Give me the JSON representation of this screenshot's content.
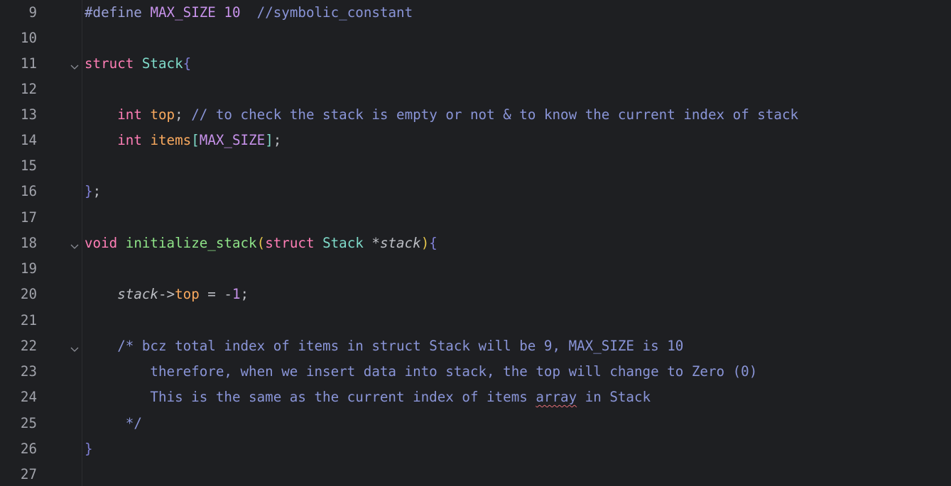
{
  "colors": {
    "background": "#1e1f22",
    "line_number": "#a1a3ab",
    "keyword": "#ff7eb6",
    "type": "#7fdbca",
    "function": "#8fe388",
    "field": "#f9a95e",
    "macro": "#c792ea",
    "comment": "#8a95d8"
  },
  "lines": [
    {
      "n": "9"
    },
    {
      "n": "10"
    },
    {
      "n": "11"
    },
    {
      "n": "12"
    },
    {
      "n": "13"
    },
    {
      "n": "14"
    },
    {
      "n": "15"
    },
    {
      "n": "16"
    },
    {
      "n": "17"
    },
    {
      "n": "18"
    },
    {
      "n": "19"
    },
    {
      "n": "20"
    },
    {
      "n": "21"
    },
    {
      "n": "22"
    },
    {
      "n": "23"
    },
    {
      "n": "24"
    },
    {
      "n": "25"
    },
    {
      "n": "26"
    },
    {
      "n": "27"
    }
  ],
  "code": {
    "l9_define": "#define",
    "l9_name": "MAX_SIZE",
    "l9_value": "10",
    "l9_comment": "//symbolic_constant",
    "l11_struct": "struct",
    "l11_name": "Stack",
    "l11_brace": "{",
    "l13_int": "int",
    "l13_top": "top",
    "l13_semi": ";",
    "l13_comment": "// to check the stack is empty or not & to know the current index of stack",
    "l14_int": "int",
    "l14_items": "items",
    "l14_lb": "[",
    "l14_max": "MAX_SIZE",
    "l14_rb": "]",
    "l14_semi": ";",
    "l16_close": "}",
    "l16_semi": ";",
    "l18_void": "void",
    "l18_fn": "initialize_stack",
    "l18_lp": "(",
    "l18_struct": "struct",
    "l18_type": "Stack",
    "l18_star": "*",
    "l18_param": "stack",
    "l18_rp": ")",
    "l18_brace": "{",
    "l20_stack": "stack",
    "l20_arrow": "->",
    "l20_top": "top",
    "l20_eq": " = ",
    "l20_minus": "-",
    "l20_num": "1",
    "l20_semi": ";",
    "l22_comment": "/* bcz total index of items in struct Stack will be 9, MAX_SIZE is 10",
    "l23_comment": "therefore, when we insert data into stack, the top will change to Zero (0)",
    "l24_pre": "This is the same as the current index of items ",
    "l24_squig": "array",
    "l24_post": " in Stack",
    "l25_comment": "*/",
    "l26_close": "}"
  },
  "fold_icons": [
    "chevron-down-icon",
    "chevron-down-icon",
    "chevron-down-icon"
  ]
}
